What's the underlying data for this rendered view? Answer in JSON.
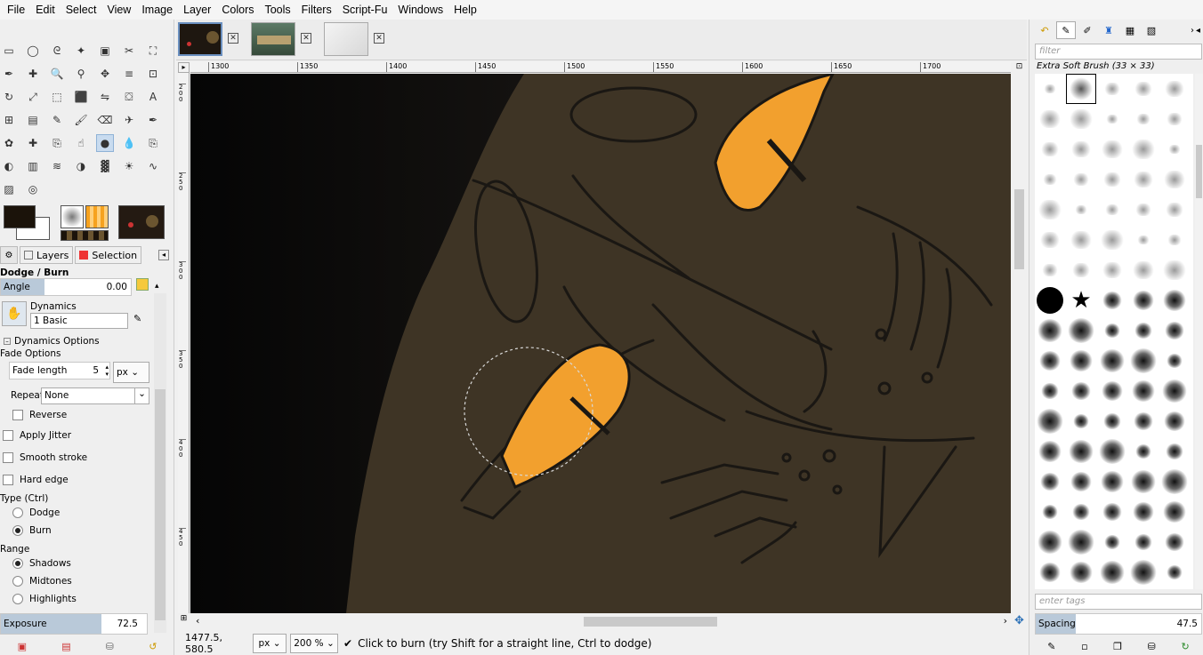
{
  "menu": [
    "File",
    "Edit",
    "Select",
    "View",
    "Image",
    "Layer",
    "Colors",
    "Tools",
    "Filters",
    "Script-Fu",
    "Windows",
    "Help"
  ],
  "tool_icons": [
    "rect-select-icon",
    "ellipse-select-icon",
    "free-select-icon",
    "fuzzy-select-icon",
    "color-select-icon",
    "scissors-icon",
    "foreground-select-icon",
    "paths-icon",
    "color-picker-icon",
    "zoom-icon",
    "measure-icon",
    "move-icon",
    "align-icon",
    "crop-icon",
    "rotate-icon",
    "scale-icon",
    "shear-icon",
    "perspective-icon",
    "flip-icon",
    "cage-icon",
    "text-icon",
    "unified-transform-icon",
    "blend-icon",
    "pencil-icon",
    "paintbrush-icon",
    "eraser-icon",
    "airbrush-icon",
    "ink-icon",
    "mypaint-icon",
    "heal-icon",
    "clone-icon",
    "smudge-icon",
    "dodge-burn-icon",
    "blur-icon",
    "perspective-clone-icon",
    "color-balance-icon",
    "levels-icon",
    "curves-icon",
    "hue-icon",
    "threshold-icon",
    "brightness-icon",
    "warp-icon",
    "bucket-fill-icon",
    "spiral-icon"
  ],
  "dock_tabs": {
    "layers": "Layers",
    "selection": "Selection"
  },
  "tool_options": {
    "title": "Dodge / Burn",
    "angle_label": "Angle",
    "angle_value": "0.00",
    "angle_fraction": 0.33,
    "dynamics_label": "Dynamics",
    "dynamics_value": "1 Basic",
    "dynamics_options": "Dynamics Options",
    "fade_options": "Fade Options",
    "fade_length_label": "Fade length",
    "fade_length_value": "5",
    "fade_unit": "px",
    "repeat_label": "Repeat:",
    "repeat_value": "None",
    "reverse": "Reverse",
    "apply_jitter": "Apply Jitter",
    "smooth_stroke": "Smooth stroke",
    "hard_edge": "Hard edge",
    "type_label": "Type  (Ctrl)",
    "type_dodge": "Dodge",
    "type_burn": "Burn",
    "range_label": "Range",
    "range_shadows": "Shadows",
    "range_midtones": "Midtones",
    "range_highlights": "Highlights",
    "exposure_label": "Exposure",
    "exposure_value": "72.5",
    "exposure_fraction": 0.68
  },
  "ruler_h": [
    "1300",
    "1350",
    "1400",
    "1450",
    "1500",
    "1550",
    "1600",
    "1650",
    "1700"
  ],
  "ruler_v": [
    "200",
    "250",
    "300",
    "350",
    "400",
    "450"
  ],
  "status": {
    "coords": "1477.5, 580.5",
    "unit": "px",
    "zoom": "200 %",
    "message": "Click to burn (try Shift for a straight line, Ctrl to dodge)"
  },
  "brushes": {
    "filter_placeholder": "filter",
    "current": "Extra Soft Brush (33 × 33)",
    "tags_placeholder": "enter tags",
    "spacing_label": "Spacing",
    "spacing_value": "47.5",
    "spacing_fraction": 0.24
  },
  "colors": {
    "canvas_bg": "#3e3425",
    "eye": "#f2a02e",
    "line": "#1a1713",
    "fg": "#1b130a"
  }
}
